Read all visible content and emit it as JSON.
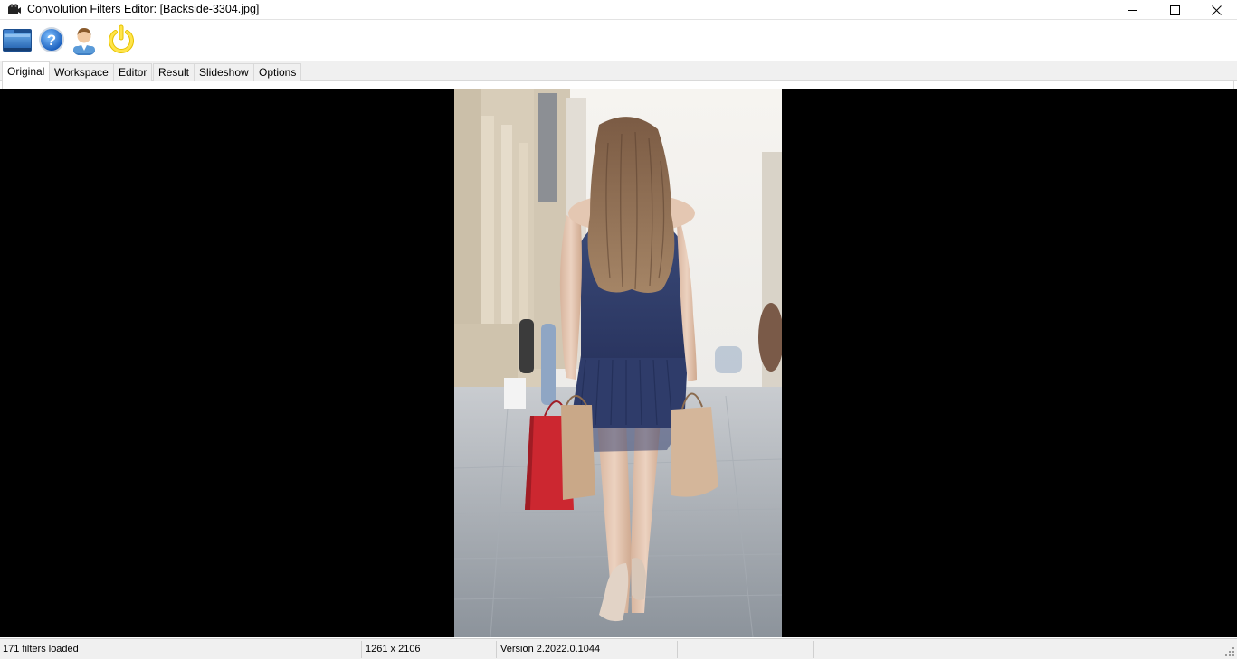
{
  "window": {
    "title": "Convolution Filters Editor: [Backside-3304.jpg]",
    "controls": [
      "minimize",
      "maximize",
      "close"
    ]
  },
  "toolbar": {
    "buttons": [
      {
        "name": "open-folder",
        "icon": "folder-icon"
      },
      {
        "name": "help",
        "icon": "help-icon"
      },
      {
        "name": "about",
        "icon": "user-icon"
      },
      {
        "name": "exit",
        "icon": "power-icon"
      }
    ]
  },
  "tabs": [
    "Original",
    "Workspace",
    "Editor",
    "Result",
    "Slideshow",
    "Options"
  ],
  "active_tab": "Original",
  "status": {
    "filters": "171 filters loaded",
    "dimensions": "1261 x 2106",
    "version": "Version 2.2022.0.1044",
    "extra1": "",
    "extra2": ""
  },
  "colors": {
    "viewer_bg": "#000000",
    "chrome_bg": "#f0f0f0",
    "help_blue": "#1a6fd1",
    "power_yellow": "#f2d21b"
  }
}
